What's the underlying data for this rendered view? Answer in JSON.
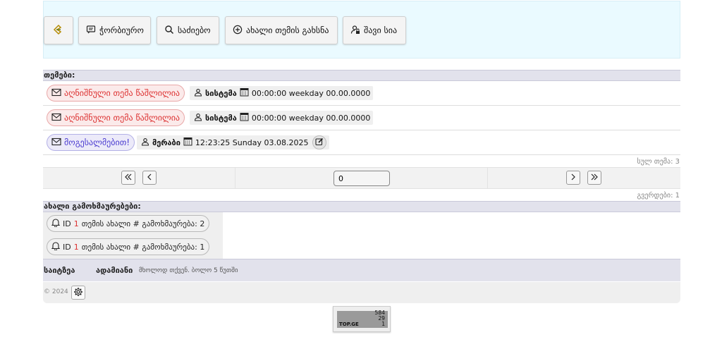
{
  "toolbar": {
    "home_icon": "logo-icon",
    "forum_label": "ჭორბიურო",
    "search_label": "საძიებო",
    "new_topic_label": "ახალი თემის გახსნა",
    "blacklist_label": "შავი სია"
  },
  "topics": {
    "header": "თემები:",
    "rows": [
      {
        "title": "აღნიშნული თემა წაშლილია",
        "author": "სისტემა",
        "datetime": "00:00:00 weekday 00.00.0000",
        "style": "deleted"
      },
      {
        "title": "აღნიშნული თემა წაშლილია",
        "author": "სისტემა",
        "datetime": "00:00:00 weekday 00.00.0000",
        "style": "deleted"
      },
      {
        "title": "მოგესალმებით!",
        "author": "მერაბი",
        "datetime": "12:23:25 Sunday 03.08.2025",
        "style": "active"
      }
    ],
    "total": "სულ თემა: 3"
  },
  "pager": {
    "page_input_value": "0",
    "pages": "გვერდები: 1"
  },
  "notifications": {
    "header": "ახალი გამოხმაურებები:",
    "items": [
      {
        "id_label": "ID",
        "id": "1",
        "text": "თემის ახალი # გამოხმაურება: 2"
      },
      {
        "id_label": "ID",
        "id": "1",
        "text": "თემის ახალი # გამოხმაურება: 1"
      }
    ]
  },
  "footer": {
    "site_label": "საიტზეა",
    "person_label": "ადამიანი",
    "only_you": "მხოლოდ თქვენ. ბოლო 5 წუთში"
  },
  "bottom": {
    "copyright": "© 2024"
  },
  "counter": {
    "brand": "TOP.GE",
    "values": [
      "584",
      "29",
      "1"
    ]
  }
}
